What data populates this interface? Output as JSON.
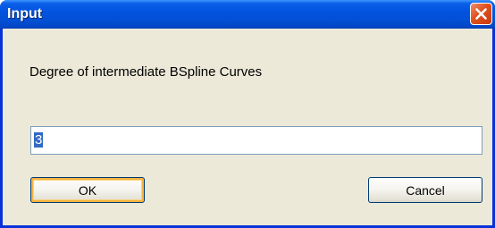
{
  "window": {
    "title": "Input"
  },
  "dialog": {
    "prompt": "Degree of intermediate BSpline Curves",
    "input_value": "3"
  },
  "buttons": {
    "ok_label": "OK",
    "cancel_label": "Cancel"
  },
  "icons": {
    "close": "close-icon"
  },
  "colors": {
    "titlebar": "#0353e1",
    "close_button": "#e0501c",
    "client_background": "#ece9d8",
    "selection_highlight": "#316ac5",
    "default_button_focus": "#f8b33c"
  }
}
